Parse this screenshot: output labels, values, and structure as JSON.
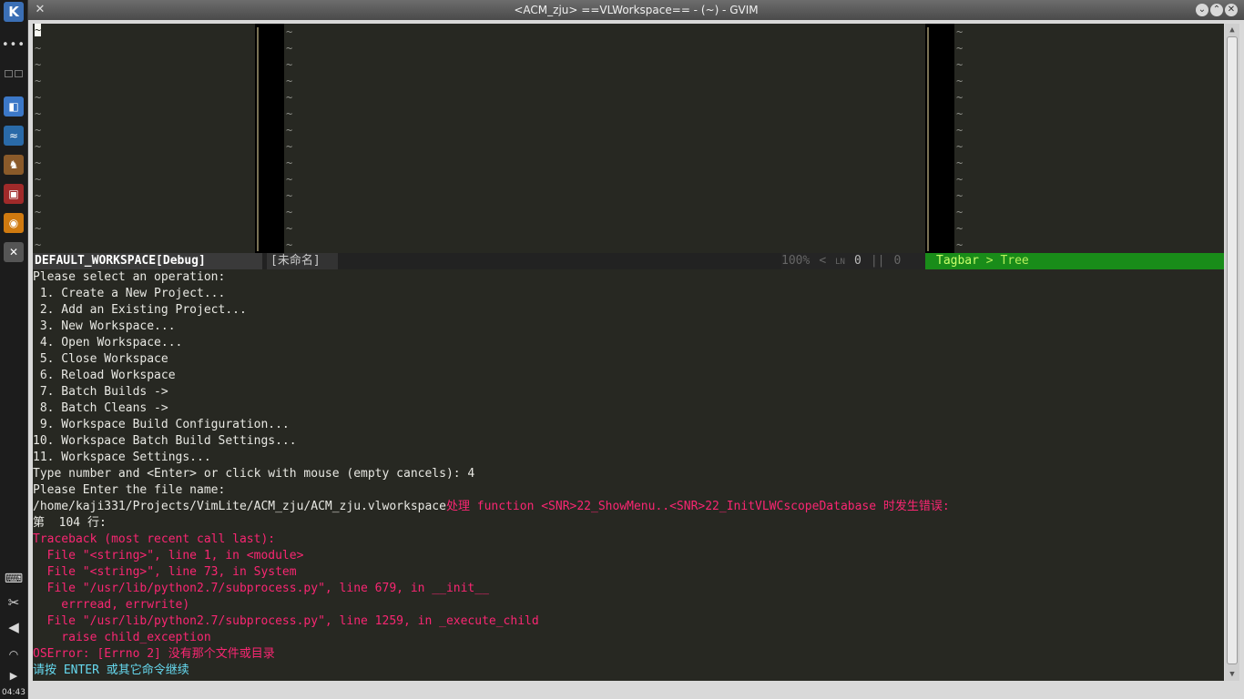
{
  "window": {
    "title": "<ACM_zju> ==VLWorkspace== - (~) - GVIM"
  },
  "panel": {
    "clock": "04:43"
  },
  "panes": {
    "tilde": "~",
    "row_count": 14
  },
  "statusline": {
    "left": "DEFAULT_WORKSPACE[Debug]",
    "buffer": "[未命名]",
    "percent": "100%",
    "arrow": "<",
    "ln_icon": "LN",
    "line_num": "0",
    "sep": "||",
    "col_num": "0",
    "tagbar": "Tagbar",
    "tree_sep": ">",
    "tree": "Tree"
  },
  "messages": [
    {
      "text": "Please select an operation:",
      "kind": "normal"
    },
    {
      "text": " 1. Create a New Project...",
      "kind": "normal"
    },
    {
      "text": " 2. Add an Existing Project...",
      "kind": "normal"
    },
    {
      "text": " 3. New Workspace...",
      "kind": "normal"
    },
    {
      "text": " 4. Open Workspace...",
      "kind": "normal"
    },
    {
      "text": " 5. Close Workspace",
      "kind": "normal"
    },
    {
      "text": " 6. Reload Workspace",
      "kind": "normal"
    },
    {
      "text": " 7. Batch Builds ->",
      "kind": "normal"
    },
    {
      "text": " 8. Batch Cleans ->",
      "kind": "normal"
    },
    {
      "text": " 9. Workspace Build Configuration...",
      "kind": "normal"
    },
    {
      "text": "10. Workspace Batch Build Settings...",
      "kind": "normal"
    },
    {
      "text": "11. Workspace Settings...",
      "kind": "normal"
    },
    {
      "text": "Type number and <Enter> or click with mouse (empty cancels): 4",
      "kind": "normal"
    },
    {
      "text": "Please Enter the file name:",
      "kind": "normal"
    }
  ],
  "path_line": {
    "path": "/home/kaji331/Projects/VimLite/ACM_zju/ACM_zju.vlworkspace",
    "error": "处理 function <SNR>22_ShowMenu..<SNR>22_InitVLWCscopeDatabase 时发生错误:"
  },
  "line_no": "第  104 行:",
  "traceback": [
    "Traceback (most recent call last):",
    "  File \"<string>\", line 1, in <module>",
    "  File \"<string>\", line 73, in System",
    "  File \"/usr/lib/python2.7/subprocess.py\", line 679, in __init__",
    "    errread, errwrite)",
    "  File \"/usr/lib/python2.7/subprocess.py\", line 1259, in _execute_child",
    "    raise child_exception",
    "OSError: [Errno 2] 没有那个文件或目录"
  ],
  "prompt": "请按 ENTER 或其它命令继续"
}
